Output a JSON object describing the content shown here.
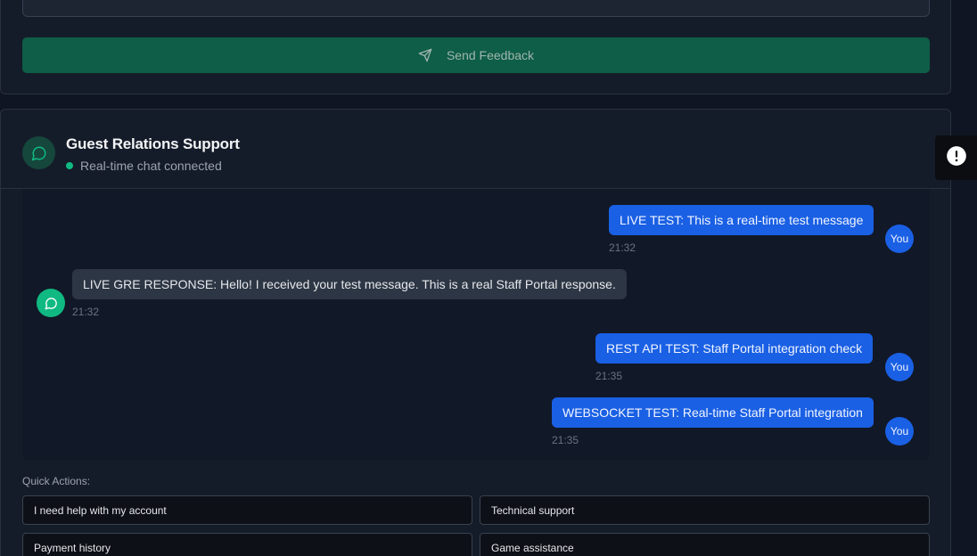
{
  "feedback": {
    "send_label": "Send Feedback"
  },
  "chat": {
    "title": "Guest Relations Support",
    "status": "Real-time chat connected",
    "messages": [
      {
        "from": "user",
        "text": "LIVE TEST: This is a real-time test message",
        "time": "21:32",
        "avatar": "You"
      },
      {
        "from": "agent",
        "text": "LIVE GRE RESPONSE: Hello! I received your test message. This is a real Staff Portal response.",
        "time": "21:32"
      },
      {
        "from": "user",
        "text": "REST API TEST: Staff Portal integration check",
        "time": "21:35",
        "avatar": "You"
      },
      {
        "from": "user",
        "text": "WEBSOCKET TEST: Real-time Staff Portal integration",
        "time": "21:35",
        "avatar": "You"
      }
    ]
  },
  "quick_actions": {
    "label": "Quick Actions:",
    "items": [
      "I need help with my account",
      "Technical support",
      "Payment history",
      "Game assistance"
    ]
  },
  "colors": {
    "accent_green": "#10b981",
    "user_bubble": "#1a60e4",
    "background": "#0f1522"
  },
  "icons": [
    "send-icon",
    "chat-bubble-icon",
    "feedback-toggle-icon"
  ]
}
